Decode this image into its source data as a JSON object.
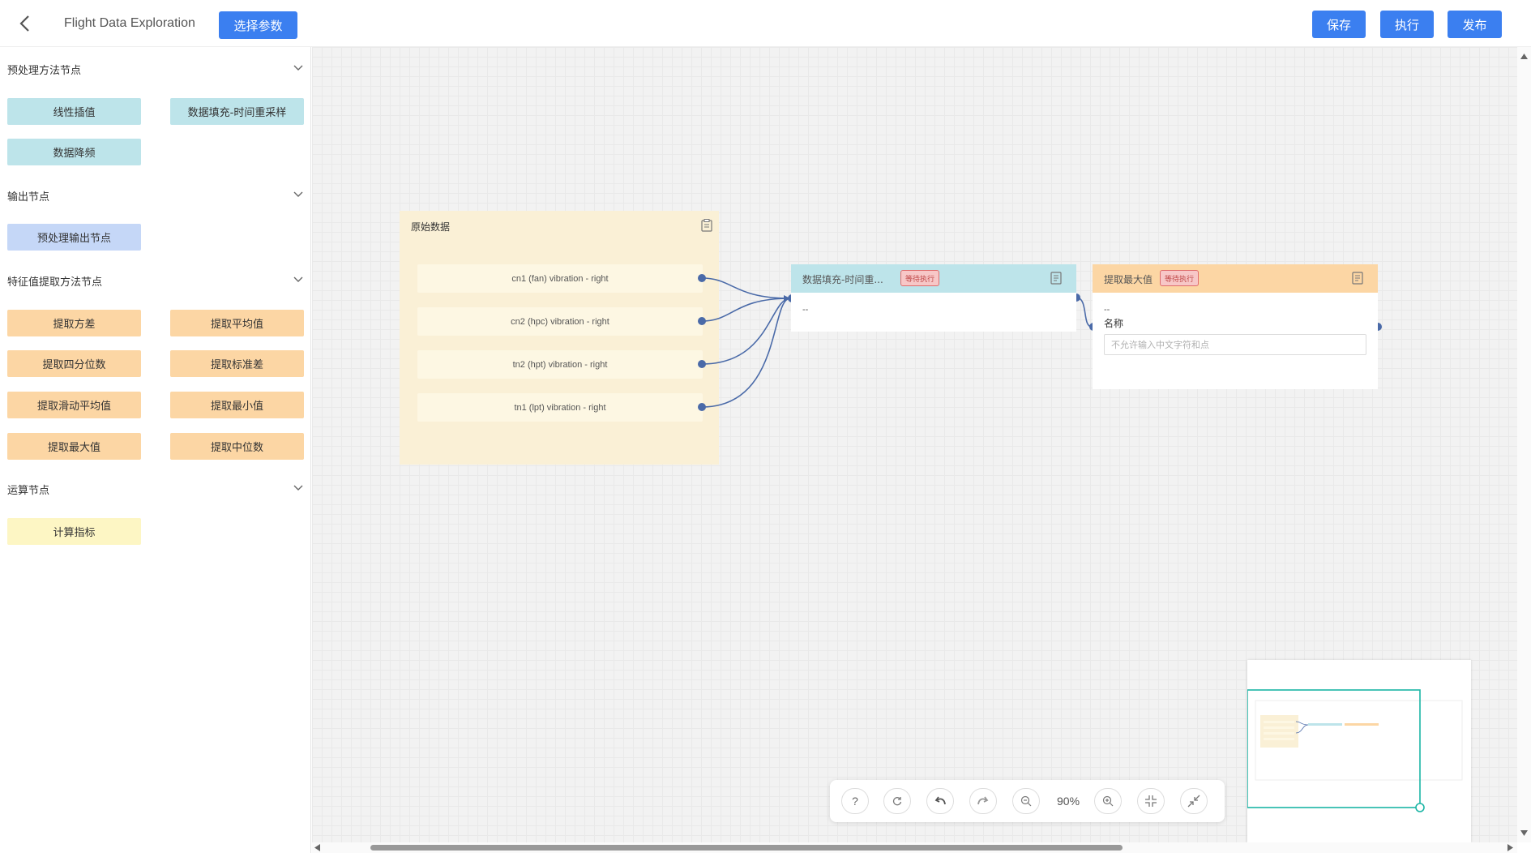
{
  "header": {
    "title": "Flight Data Exploration",
    "select_params_label": "选择参数",
    "save_label": "保存",
    "execute_label": "执行",
    "publish_label": "发布"
  },
  "sidebar": {
    "sections": [
      {
        "title": "预处理方法节点",
        "items": [
          "线性插值",
          "数据填充-时间重采样",
          "数据降频"
        ]
      },
      {
        "title": "输出节点",
        "items": [
          "预处理输出节点"
        ]
      },
      {
        "title": "特征值提取方法节点",
        "items": [
          "提取方差",
          "提取平均值",
          "提取四分位数",
          "提取标准差",
          "提取滑动平均值",
          "提取最小值",
          "提取最大值",
          "提取中位数"
        ]
      },
      {
        "title": "运算节点",
        "items": [
          "计算指标"
        ]
      }
    ]
  },
  "canvas": {
    "source_node": {
      "title": "原始数据",
      "fields": [
        "cn1 (fan) vibration - right",
        "cn2 (hpc) vibration - right",
        "tn2 (hpt) vibration - right",
        "tn1 (lpt) vibration - right"
      ]
    },
    "fill_node": {
      "title": "数据填充-时间重...",
      "status": "等待执行",
      "body": "--"
    },
    "max_node": {
      "title": "提取最大值",
      "status": "等待执行",
      "body": "--",
      "name_label": "名称",
      "name_placeholder": "不允许输入中文字符和点"
    }
  },
  "toolbar": {
    "zoom": "90%",
    "help": "?"
  },
  "colors": {
    "accent": "#3b7ff0",
    "teal_chip": "#bde4ea",
    "blue_chip": "#c5d7f7",
    "orange_chip": "#fcd6a4",
    "yellow_chip": "#fdf6c4",
    "source_bg": "#faf0d6",
    "edge": "#4a6aa8",
    "minimap_frame": "#1bb5a5"
  }
}
